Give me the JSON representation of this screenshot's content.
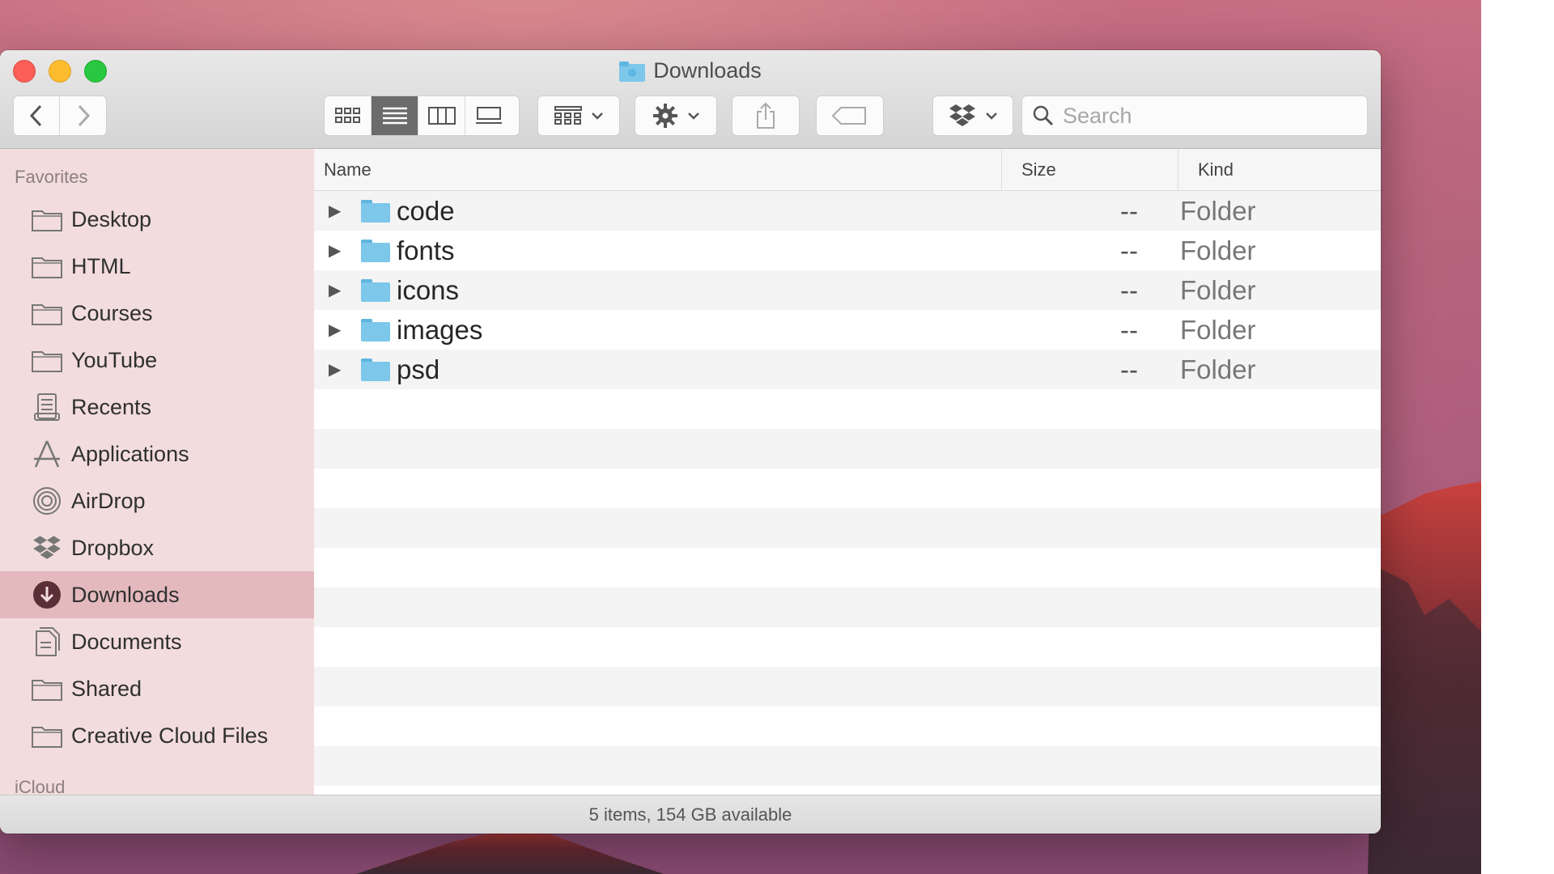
{
  "window": {
    "title": "Downloads"
  },
  "toolbar": {
    "back_icon": "chevron-left-icon",
    "forward_icon": "chevron-right-icon",
    "view_modes": [
      "icon-view",
      "list-view",
      "column-view",
      "gallery-view"
    ],
    "active_view": "list-view",
    "group_icon": "group-by-icon",
    "action_icon": "gear-icon",
    "share_icon": "share-icon",
    "tag_icon": "tag-icon",
    "dropbox_icon": "dropbox-icon",
    "search": {
      "placeholder": "Search",
      "value": ""
    }
  },
  "sidebar": {
    "section_favorites": "Favorites",
    "items": [
      {
        "label": "Desktop",
        "icon": "folder-icon"
      },
      {
        "label": "HTML",
        "icon": "folder-icon"
      },
      {
        "label": "Courses",
        "icon": "folder-icon"
      },
      {
        "label": "YouTube",
        "icon": "folder-icon"
      },
      {
        "label": "Recents",
        "icon": "recents-icon"
      },
      {
        "label": "Applications",
        "icon": "applications-icon"
      },
      {
        "label": "AirDrop",
        "icon": "airdrop-icon"
      },
      {
        "label": "Dropbox",
        "icon": "dropbox-icon"
      },
      {
        "label": "Downloads",
        "icon": "downloads-icon",
        "selected": true
      },
      {
        "label": "Documents",
        "icon": "documents-icon"
      },
      {
        "label": "Shared",
        "icon": "folder-icon"
      },
      {
        "label": "Creative Cloud Files",
        "icon": "folder-icon"
      }
    ],
    "section_icloud": "iCloud"
  },
  "list": {
    "columns": {
      "name": "Name",
      "size": "Size",
      "kind": "Kind"
    },
    "rows": [
      {
        "name": "code",
        "size": "--",
        "kind": "Folder"
      },
      {
        "name": "fonts",
        "size": "--",
        "kind": "Folder"
      },
      {
        "name": "icons",
        "size": "--",
        "kind": "Folder"
      },
      {
        "name": "images",
        "size": "--",
        "kind": "Folder"
      },
      {
        "name": "psd",
        "size": "--",
        "kind": "Folder"
      }
    ]
  },
  "status": {
    "text": "5 items, 154 GB available"
  },
  "colors": {
    "folder": "#7cc7ea",
    "sidebar_bg": "#f2dcdd",
    "sidebar_selected": "#e3b9bd",
    "close": "#fc5f57",
    "minimize": "#fdbc2e",
    "maximize": "#28c840"
  }
}
